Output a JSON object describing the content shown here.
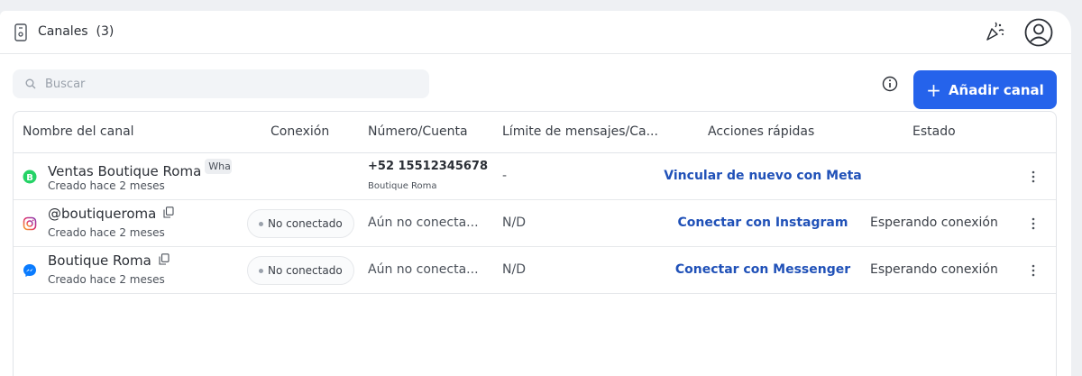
{
  "header": {
    "title": "Canales",
    "count": "(3)",
    "icons": [
      "channel-icon",
      "party-popper-icon",
      "user-avatar-icon"
    ]
  },
  "toolbar": {
    "search_placeholder": "Buscar",
    "add_button_plus": "+",
    "add_button_label": "Añadir canal"
  },
  "table": {
    "columns": [
      "Nombre del canal",
      "Conexión",
      "Número/Cuenta",
      "Límite de mensajes/Ca...",
      "Acciones rápidas",
      "Estado"
    ],
    "rows": [
      {
        "channel_icon": "whatsapp-business-icon",
        "name": "Ventas Boutique Roma",
        "tag": "Wha",
        "created": "Creado hace 2 meses",
        "connection": "",
        "number": "+52 15512345678",
        "number_sub": "Boutique Roma",
        "limit": "-",
        "action": "Vincular de nuevo con Meta",
        "status": ""
      },
      {
        "channel_icon": "instagram-icon",
        "name": "@boutiqueroma",
        "created": "Creado hace 2 meses",
        "connection": "No conectado",
        "number": "Aún no conecta...",
        "limit": "N/D",
        "action": "Conectar con Instagram",
        "status": "Esperando conexión"
      },
      {
        "channel_icon": "messenger-icon",
        "name": "Boutique Roma",
        "created": "Creado hace 2 meses",
        "connection": "No conectado",
        "number": "Aún no conecta...",
        "limit": "N/D",
        "action": "Conectar con Messenger",
        "status": "Esperando conexión"
      }
    ]
  },
  "colors": {
    "primary": "#2563eb",
    "action_link": "#2051b8",
    "whatsapp": "#25d366",
    "messenger": "#0a7cff"
  }
}
